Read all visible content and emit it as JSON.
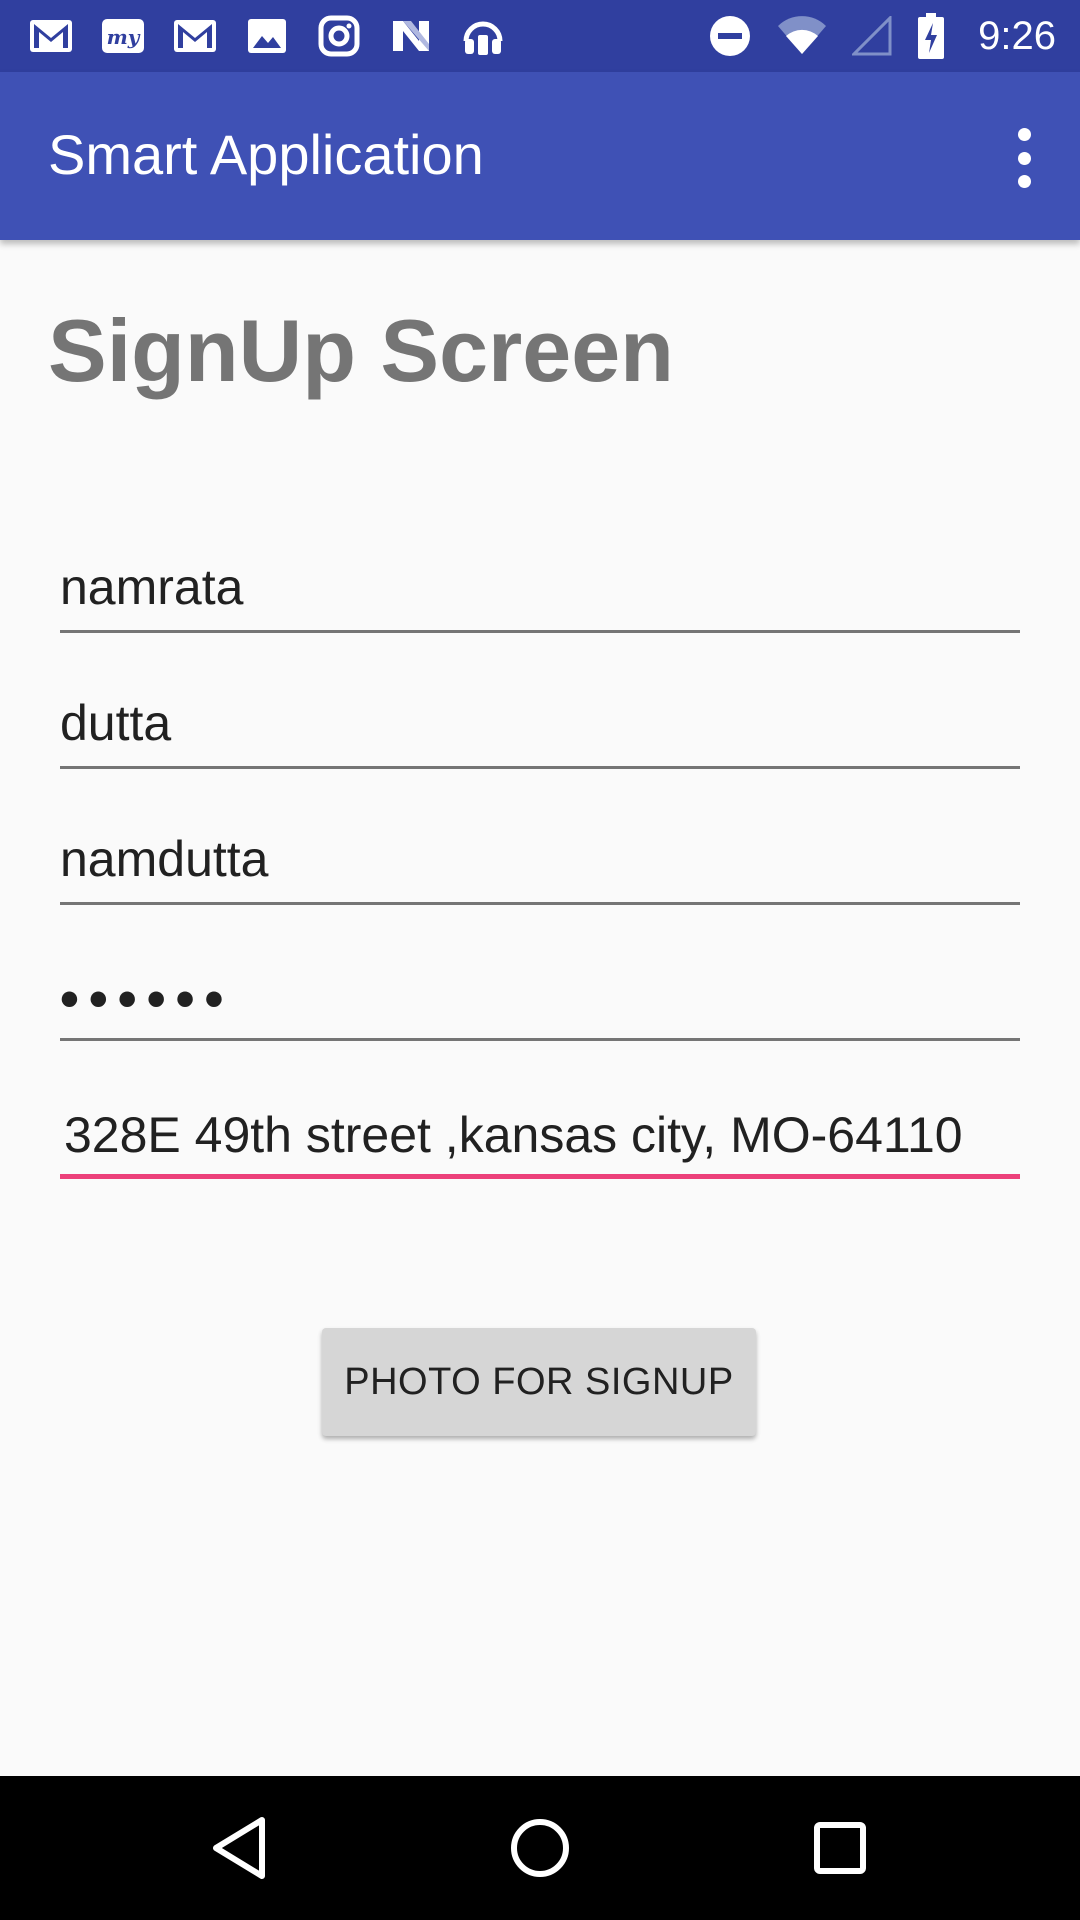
{
  "status_bar": {
    "time": "9:26",
    "notification_icons": [
      "gmail-icon",
      "myntra-icon",
      "gmail-icon",
      "gallery-icon",
      "instagram-icon",
      "nova-icon",
      "headphones-icon"
    ],
    "system_icons": [
      "do-not-disturb-icon",
      "wifi-icon",
      "cell-signal-icon",
      "battery-charging-icon"
    ]
  },
  "app_bar": {
    "title": "Smart Application",
    "menu_icon": "overflow-menu-icon",
    "color": "#3f51b5"
  },
  "main": {
    "page_title": "SignUp Screen",
    "fields": {
      "first_name": "namrata",
      "last_name": "dutta",
      "username": "namdutta",
      "password": "••••••",
      "address": "328E 49th street ,kansas city, MO-64110"
    },
    "photo_button_label": "PHOTO FOR SIGNUP",
    "accent_color": "#ec407a"
  },
  "nav_bar": {
    "back_icon": "back-icon",
    "home_icon": "home-icon",
    "recents_icon": "recents-icon"
  }
}
